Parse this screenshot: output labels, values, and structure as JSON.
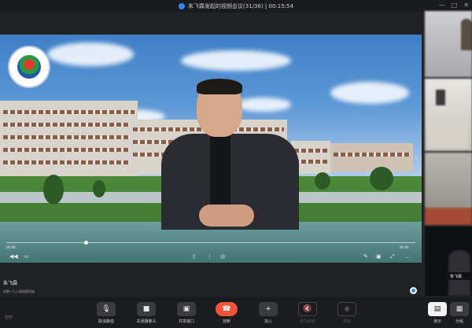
{
  "window": {
    "title": "朱飞霖发起的视频会议(31/36) | 00:15:54",
    "controls": [
      "—",
      "□",
      "✕"
    ]
  },
  "presenter": {
    "name": "朱飞霖",
    "org": "合肥一六八高地国学校"
  },
  "player": {
    "time_left": "00:00",
    "time_right": "00:00",
    "progress_fraction": 0.19
  },
  "sidebar": {
    "tile_label": "朱飞霖"
  },
  "toolbar": {
    "left_label": "打印",
    "items": [
      {
        "label": "取消静音",
        "icon": "mic-icon"
      },
      {
        "label": "关闭摄像头",
        "icon": "camera-icon"
      },
      {
        "label": "共享窗口",
        "icon": "screen-share-icon"
      },
      {
        "label": "挂断",
        "icon": "hangup-icon"
      },
      {
        "label": "加入",
        "icon": "add-user-icon"
      },
      {
        "label": "",
        "icon": "mute-all-icon"
      },
      {
        "label": "全员静音",
        "icon": "mute-all-icon"
      },
      {
        "label": "录制",
        "icon": "record-icon"
      }
    ],
    "right_items": [
      {
        "label": "演示",
        "icon": "layout-icon"
      },
      {
        "label": "分组",
        "icon": "grid-icon"
      }
    ]
  },
  "colors": {
    "accent": "#2f86f6",
    "hangup": "#f0553a",
    "background": "#202124"
  }
}
